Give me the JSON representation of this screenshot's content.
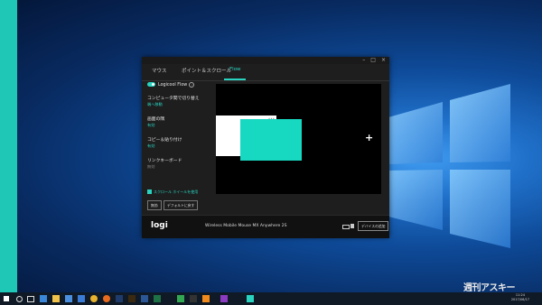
{
  "app": {
    "tabs": [
      {
        "label": "マウス"
      },
      {
        "label": "ポイント＆スクロール"
      },
      {
        "label": "Flow"
      }
    ],
    "flow_toggle_label": "Logicool Flow",
    "settings": [
      {
        "label": "コンピュータ間で切り替え",
        "value": "端へ移動"
      },
      {
        "label": "画面の隅",
        "value": "有効"
      },
      {
        "label": "コピー＆貼り付け",
        "value": "有効"
      },
      {
        "label": "リンクキーボード",
        "value": "無効"
      }
    ],
    "checkbox_label": "スクロール ホイールを使用",
    "buttons": {
      "disable": "無効",
      "defaults": "デフォルトに戻す"
    },
    "footer": {
      "brand": "logi",
      "device_name": "Wireless Mobile Mouse MX Anywhere 2S",
      "add_device": "デバイスの追加"
    },
    "window_controls": [
      "–",
      "□",
      "×"
    ],
    "accent_color": "#29d3c0"
  },
  "taskbar": {
    "time": "11:24",
    "date": "2017/06/17",
    "icons": [
      "start-icon",
      "search-icon",
      "task-view-icon",
      "edge-icon",
      "explorer-icon",
      "store-icon",
      "mail-icon",
      "chrome-icon",
      "firefox-icon",
      "photoshop-icon",
      "illustrator-icon",
      "word-icon",
      "excel-icon",
      "maps-icon",
      "terminal-icon",
      "vlc-icon",
      "media-icon",
      "logi-options-icon"
    ]
  },
  "watermark": "週刊アスキー"
}
